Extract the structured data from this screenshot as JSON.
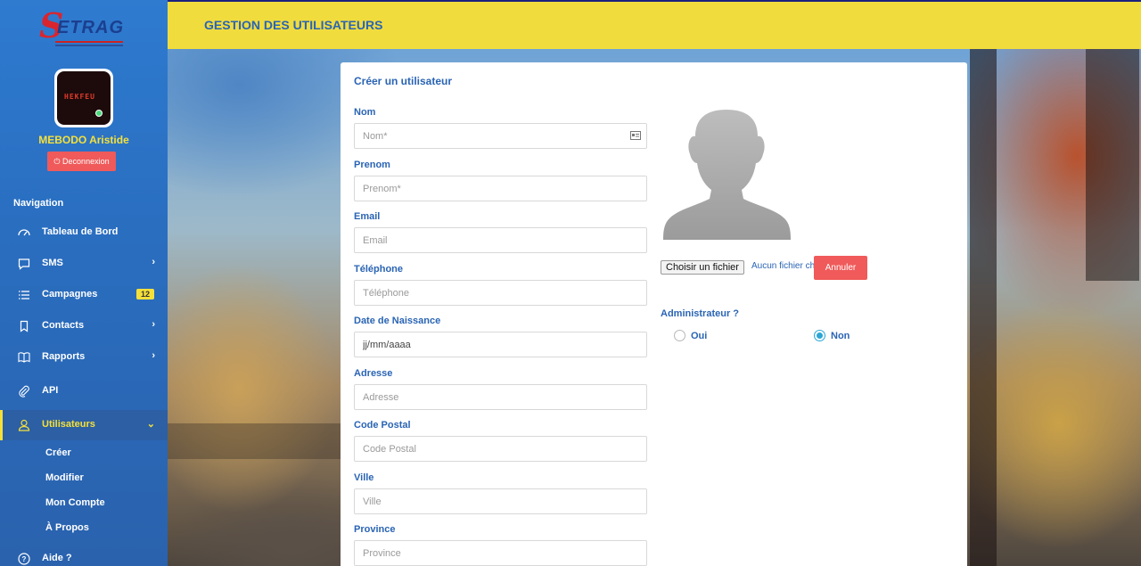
{
  "brand": {
    "logo_text": "ETRAG",
    "logo_initial": "S"
  },
  "user": {
    "name": "MEBODO Aristide",
    "avatar_text": "HEKFEU",
    "logout_label": "Deconnexion"
  },
  "sidebar": {
    "nav_title": "Navigation",
    "items": [
      {
        "label": "Tableau de Bord"
      },
      {
        "label": "SMS"
      },
      {
        "label": "Campagnes",
        "badge": "12"
      },
      {
        "label": "Contacts"
      },
      {
        "label": "Rapports"
      },
      {
        "label": "API"
      },
      {
        "label": "Utilisateurs"
      }
    ],
    "sub_items": [
      {
        "label": "Créer"
      },
      {
        "label": "Modifier"
      },
      {
        "label": "Mon Compte"
      },
      {
        "label": "À Propos"
      }
    ],
    "help_label": "Aide ?"
  },
  "header": {
    "title": "GESTION DES UTILISATEURS"
  },
  "form": {
    "title": "Créer un utilisateur",
    "fields": [
      {
        "label": "Nom",
        "placeholder": "Nom*"
      },
      {
        "label": "Prenom",
        "placeholder": "Prenom*"
      },
      {
        "label": "Email",
        "placeholder": "Email"
      },
      {
        "label": "Téléphone",
        "placeholder": "Téléphone"
      },
      {
        "label": "Date de Naissance",
        "value": "jj/mm/aaaa"
      },
      {
        "label": "Adresse",
        "placeholder": "Adresse"
      },
      {
        "label": "Code Postal",
        "placeholder": "Code Postal"
      },
      {
        "label": "Ville",
        "placeholder": "Ville"
      },
      {
        "label": "Province",
        "placeholder": "Province"
      }
    ],
    "file_button": "Choisir un fichier",
    "file_status": "Aucun fichier choisi",
    "cancel_label": "Annuler",
    "admin_label": "Administrateur ?",
    "admin_options": [
      {
        "label": "Oui",
        "selected": false
      },
      {
        "label": "Non",
        "selected": true
      }
    ]
  },
  "colors": {
    "sidebar": "#2a6ec0",
    "header": "#f1dc3e",
    "accent_text": "#2a64b4",
    "danger": "#f05a5a",
    "highlight": "#f5e03a"
  }
}
